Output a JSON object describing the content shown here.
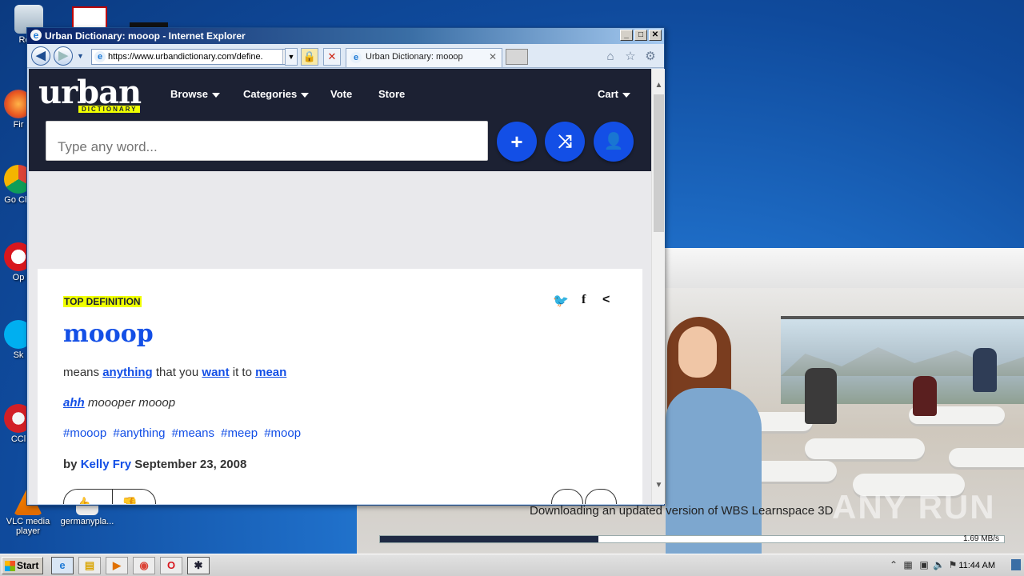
{
  "desktop": {
    "icons": [
      {
        "label": "Recy",
        "name": "recycle-bin-icon"
      },
      {
        "label": "Fir",
        "name": "firefox-icon"
      },
      {
        "label": "Go Chr",
        "name": "chrome-icon"
      },
      {
        "label": "Op",
        "name": "opera-icon"
      },
      {
        "label": "Sk",
        "name": "skype-icon"
      },
      {
        "label": "CCl",
        "name": "ccleaner-icon"
      },
      {
        "label": "VLC media player",
        "name": "vlc-icon"
      },
      {
        "label": "germanypla...",
        "name": "file-icon"
      }
    ]
  },
  "installer": {
    "status": "Downloading an updated version of WBS Learnspace 3D",
    "progress": 0.35,
    "speed": "1.69 MB/s",
    "watermark": "ANY RUN"
  },
  "browser": {
    "title": "Urban Dictionary: mooop - Internet Explorer",
    "address": "https://www.urbandictionary.com/define.",
    "tab_label": "Urban Dictionary: mooop",
    "colors": {
      "header_bg": "#1c2133",
      "accent": "#134fe6",
      "highlight": "#efff00"
    }
  },
  "site": {
    "logo_word": "urban",
    "logo_sub": "DICTIONARY",
    "nav": [
      {
        "label": "Browse",
        "dropdown": true
      },
      {
        "label": "Categories",
        "dropdown": true
      },
      {
        "label": "Vote",
        "dropdown": false
      },
      {
        "label": "Store",
        "dropdown": false
      }
    ],
    "cart_label": "Cart",
    "search_placeholder": "Type any word..."
  },
  "definition": {
    "badge": "TOP DEFINITION",
    "word": "mooop",
    "meaning_parts": [
      {
        "text": "means ",
        "link": false
      },
      {
        "text": "anything",
        "link": true
      },
      {
        "text": " that you ",
        "link": false
      },
      {
        "text": "want",
        "link": true
      },
      {
        "text": " it to ",
        "link": false
      },
      {
        "text": "mean",
        "link": true
      }
    ],
    "example_link": "ahh",
    "example_rest": " moooper mooop",
    "tags": [
      "#mooop",
      "#anything",
      "#means",
      "#meep",
      "#moop"
    ],
    "by_label": "by",
    "author": "Kelly Fry",
    "date": "September 23, 2008"
  },
  "taskbar": {
    "start_label": "Start",
    "clock": "11:44 AM"
  }
}
